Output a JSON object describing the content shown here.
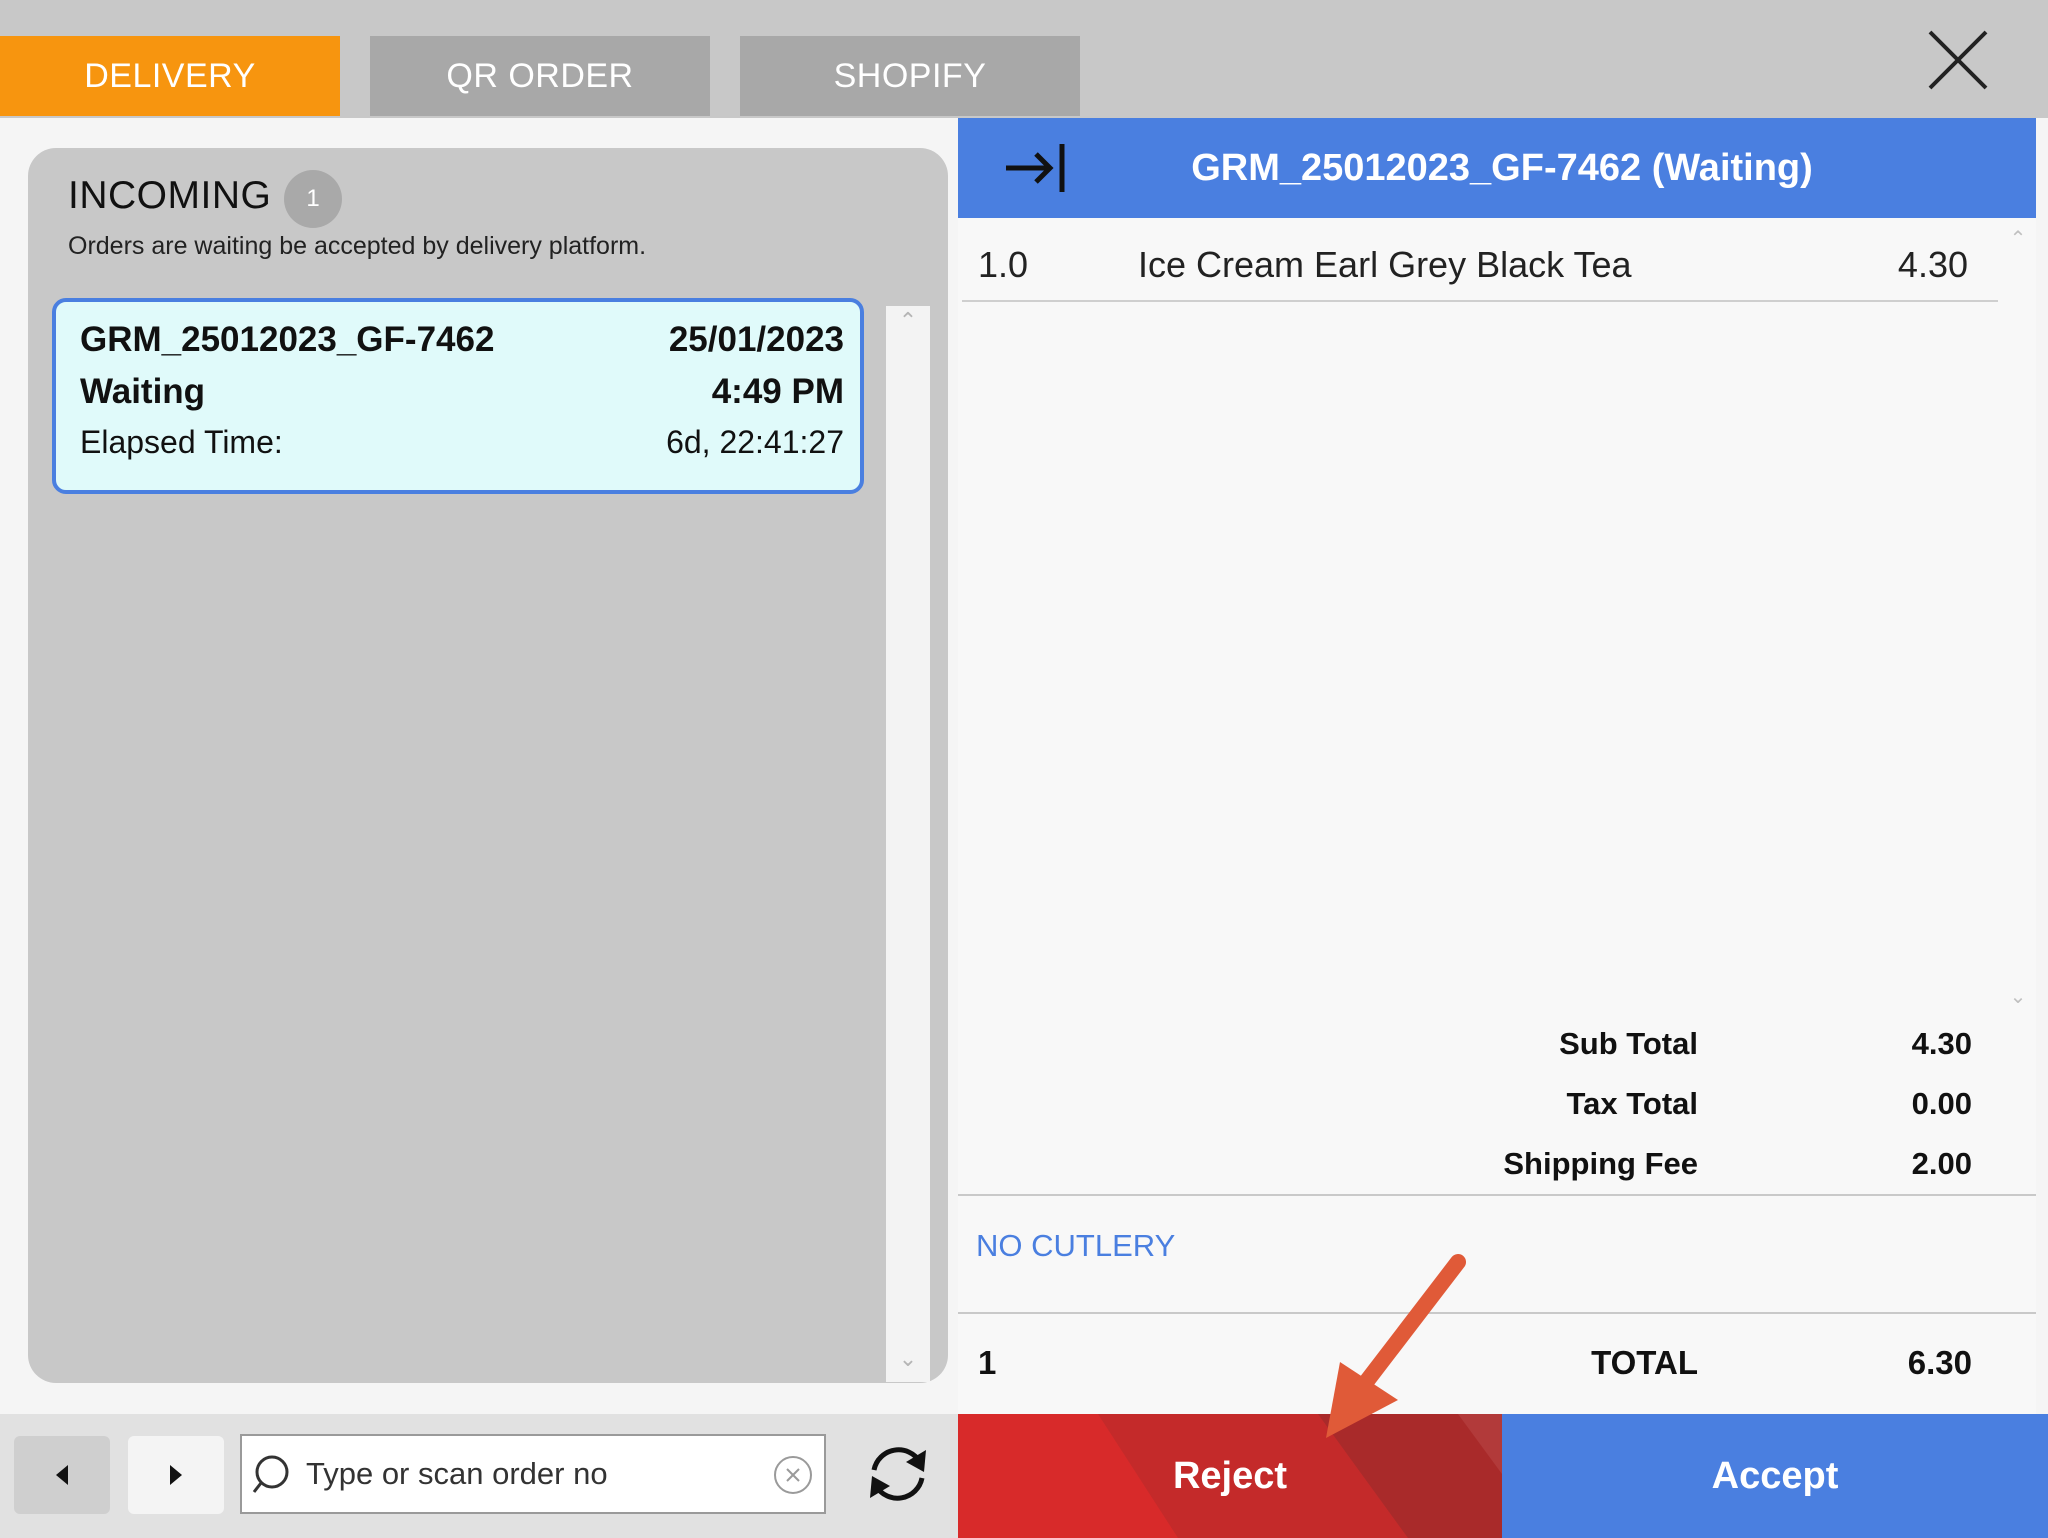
{
  "tabs": [
    {
      "label": "DELIVERY",
      "active": true
    },
    {
      "label": "QR ORDER",
      "active": false
    },
    {
      "label": "SHOPIFY",
      "active": false
    }
  ],
  "incoming": {
    "title": "INCOMING",
    "count": "1",
    "subtitle": "Orders are waiting be accepted by delivery platform."
  },
  "order_card": {
    "order_no": "GRM_25012023_GF-7462",
    "date": "25/01/2023",
    "status": "Waiting",
    "time": "4:49 PM",
    "elapsed_label": "Elapsed Time:",
    "elapsed_value": "6d,  22:41:27"
  },
  "detail": {
    "header_title": "GRM_25012023_GF-7462 (Waiting)",
    "items": [
      {
        "qty": "1.0",
        "name": "Ice Cream Earl Grey Black Tea",
        "price": "4.30"
      }
    ],
    "summary": {
      "subtotal_label": "Sub Total",
      "subtotal": "4.30",
      "tax_label": "Tax Total",
      "tax": "0.00",
      "shipping_label": "Shipping Fee",
      "shipping": "2.00"
    },
    "note": "NO CUTLERY",
    "total_qty": "1",
    "total_label": "TOTAL",
    "total": "6.30"
  },
  "search": {
    "placeholder": "Type or scan order no"
  },
  "actions": {
    "reject_label": "Reject",
    "accept_label": "Accept"
  },
  "colors": {
    "accent_orange": "#f7950f",
    "primary_blue": "#4a7fe0",
    "reject_red": "#d82a2a"
  },
  "icons": {
    "close": "close-icon",
    "collapse": "collapse-arrow-icon",
    "prev": "caret-left-icon",
    "next": "caret-right-icon",
    "search": "search-icon",
    "clear": "clear-icon",
    "refresh": "refresh-icon"
  }
}
